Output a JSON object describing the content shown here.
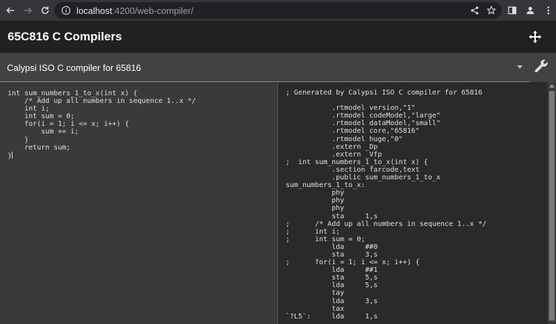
{
  "browser": {
    "url_host": "localhost",
    "url_rest": ":4200/web-compiler/"
  },
  "app": {
    "title": "65C816 C Compilers"
  },
  "compiler_select": {
    "selected": "Calypsi ISO C compiler for 65816"
  },
  "source_editor": {
    "code": "int sum_numbers_1_to_x(int x) {\n    /* Add up all numbers in sequence 1..x */\n    int i;\n    int sum = 0;\n    for(i = 1; i <= x; i++) {\n        sum += i;\n    }\n    return sum;\n}"
  },
  "output_editor": {
    "code": "; Generated by Calypsi ISO C compiler for 65816\n\n           .rtmodel version,\"1\"\n           .rtmodel codeModel,\"large\"\n           .rtmodel dataModel,\"small\"\n           .rtmodel core,\"65816\"\n           .rtmodel huge,\"0\"\n           .extern _Dp\n           .extern _Vfp\n;  int sum_numbers_1_to_x(int x) {\n           .section farcode,text\n           .public sum_numbers_1_to_x\nsum_numbers_1_to_x:\n           phy\n           phy\n           phy\n           sta     1,s\n;      /* Add up all numbers in sequence 1..x */\n;      int i;\n;      int sum = 0;\n           lda     ##0\n           sta     3,s\n;      for(i = 1; i <= x; i++) {\n           lda     ##1\n           sta     5,s\n           lda     5,s\n           tay\n           lda     3,s\n           tax\n`?L5`:     lda     1,s"
  },
  "icons": {
    "back": "arrow-left-icon",
    "forward": "arrow-right-icon",
    "reload": "reload-icon",
    "site_info": "info-icon",
    "share": "share-icon",
    "bookmark": "star-icon",
    "side_panel": "side-panel-icon",
    "profile": "person-icon",
    "menu": "more-vert-icon",
    "move": "move-arrows-icon",
    "settings": "wrench-icon"
  }
}
